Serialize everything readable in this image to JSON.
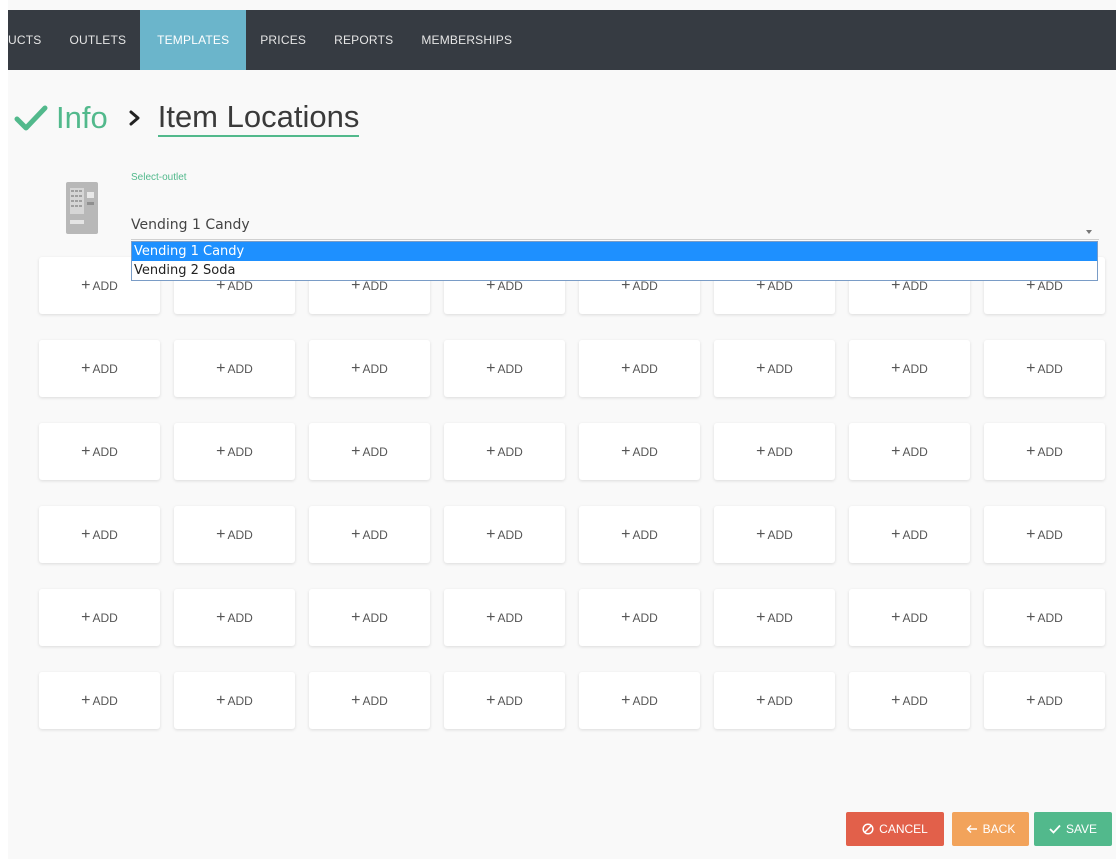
{
  "nav": {
    "items": [
      {
        "label": "UCTS",
        "active": false
      },
      {
        "label": "OUTLETS",
        "active": false
      },
      {
        "label": "TEMPLATES",
        "active": true
      },
      {
        "label": "PRICES",
        "active": false
      },
      {
        "label": "REPORTS",
        "active": false
      },
      {
        "label": "MEMBERSHIPS",
        "active": false
      }
    ]
  },
  "breadcrumb": {
    "step1": "Info",
    "current": "Item Locations"
  },
  "outlet": {
    "label": "Select-outlet",
    "value": "Vending 1 Candy",
    "options": [
      "Vending 1 Candy",
      "Vending 2 Soda"
    ],
    "selected_index": 0
  },
  "grid": {
    "rows": 6,
    "cols": 8,
    "slot_label": "ADD"
  },
  "actions": {
    "cancel": "CANCEL",
    "back": "BACK",
    "save": "SAVE"
  },
  "colors": {
    "nav_bg": "#363b42",
    "nav_active": "#6bb5cb",
    "accent_green": "#52b98c",
    "cancel_red": "#e2604a",
    "back_orange": "#f2a35b",
    "dropdown_highlight": "#1e90ff"
  }
}
